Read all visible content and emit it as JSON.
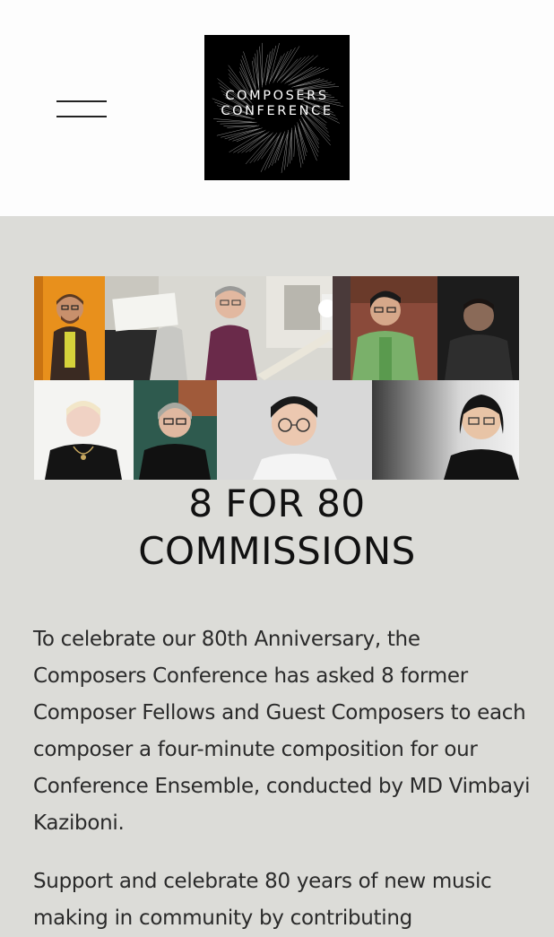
{
  "header": {
    "menu_icon": "hamburger-menu-icon",
    "logo": {
      "line1": "COMPOSERS",
      "line2": "CONFERENCE"
    }
  },
  "feature": {
    "headline_line1": "8 FOR 80",
    "headline_line2": "COMMISSIONS",
    "paragraph1": "To celebrate our 80th Anniversary, the Composers Conference has asked 8 former Composer Fellows and Guest Composers to each composer a four-minute composition for our Conference Ensemble, conducted by MD Vimbayi Kaziboni.",
    "paragraph2": "Support and celebrate 80 years of new music making in community by contributing"
  },
  "colors": {
    "page_background": "#dcdcd8",
    "header_background": "#fdfdfd",
    "logo_background": "#000000",
    "text": "#1a1a1a"
  }
}
